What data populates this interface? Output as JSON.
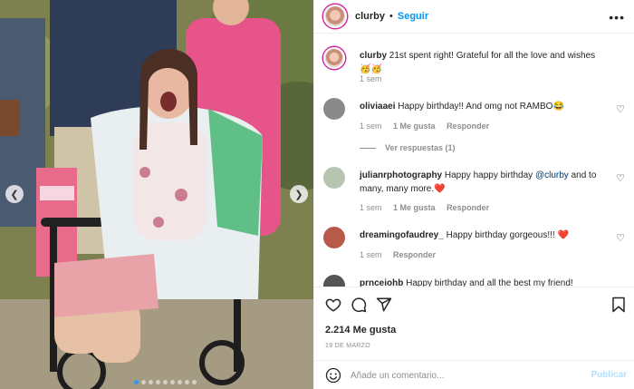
{
  "post": {
    "username": "clurby",
    "follow_label": "Seguir",
    "separator": "•",
    "caption_username": "clurby",
    "caption_text": "21st spent right! Grateful for all the love and wishes🥳🥳",
    "caption_time": "1 sem"
  },
  "comments": [
    {
      "username": "oliviaaei",
      "text": "Happy birthday!! And omg not RAMBO😂",
      "time": "1 sem",
      "likes": "1 Me gusta",
      "reply": "Responder",
      "view_replies": "Ver respuestas (1)",
      "avatar_color": "#8a8a8a"
    },
    {
      "username": "julianrphotography",
      "text_before": "Happy happy birthday ",
      "mention": "@clurby",
      "text_after": " and to many, many more.❤️",
      "time": "1 sem",
      "likes": "1 Me gusta",
      "reply": "Responder",
      "avatar_color": "#b7c4b0"
    },
    {
      "username": "dreamingofaudrey_",
      "text": "Happy birthday gorgeous!!! ❤️",
      "time": "1 sem",
      "reply": "Responder",
      "avatar_color": "#b85a4a"
    },
    {
      "username": "prnceiohb",
      "text": "Happy birthday and all the best my friend!",
      "avatar_color": "#555555"
    }
  ],
  "footer": {
    "likes": "2.214 Me gusta",
    "date": "19 DE MARZO",
    "add_comment_placeholder": "Añade un comentario...",
    "publish_label": "Publicar"
  },
  "icons": {
    "like": "heart-icon",
    "comment": "comment-icon",
    "share": "share-icon",
    "save": "bookmark-icon",
    "emoji": "emoji-icon",
    "more": "more-options-icon"
  },
  "colors": {
    "accent": "#0095f6",
    "muted": "#8e8e8e",
    "publish_disabled": "#b2dffc"
  }
}
